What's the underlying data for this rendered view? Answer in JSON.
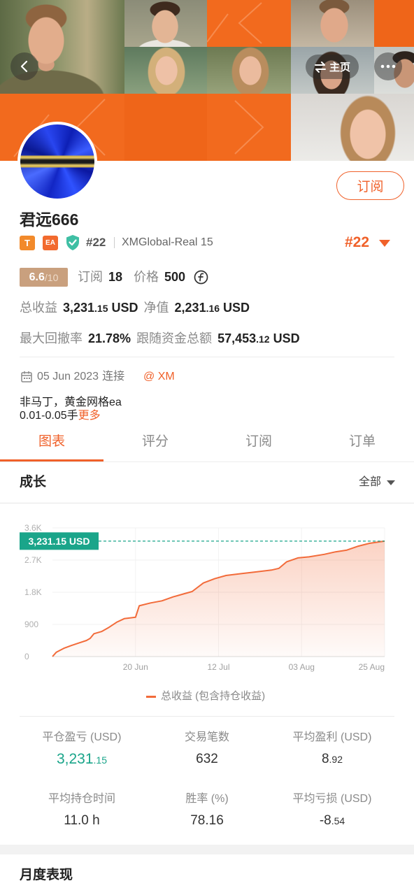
{
  "colors": {
    "accent": "#F0612A",
    "banner_orange": "#F26A1E",
    "teal": "#1AA58A",
    "rating_bg": "#C9A07E"
  },
  "header": {
    "back_icon": "chevron-left-icon",
    "home_icon": "swap-icon",
    "home_label": "主页",
    "more_icon": "more-dots-icon"
  },
  "profile": {
    "avatar": "avatar-image",
    "subscribe_label": "订阅",
    "name": "君远666",
    "badge_t": "T",
    "badge_ea": "EA",
    "verified_icon": "shield-check-icon",
    "rank": "#22",
    "account": "XMGlobal-Real 15",
    "rank_highlight": "#22",
    "rating": "6.6",
    "rating_max": "/10",
    "subscribers_label": "订阅",
    "subscribers": "18",
    "price_label": "价格",
    "price": "500",
    "price_icon": "coin-icon",
    "total_return_label": "总收益",
    "total_return_int": "3,231",
    "total_return_dec": ".15",
    "total_return_unit": "USD",
    "equity_label": "净值",
    "equity_int": "2,231",
    "equity_dec": ".16",
    "equity_unit": "USD",
    "max_drawdown_label": "最大回撤率",
    "max_drawdown": "21.78%",
    "follow_funds_label": "跟随资金总额",
    "follow_funds_int": "57,453",
    "follow_funds_dec": ".12",
    "follow_funds_unit": "USD",
    "calendar_icon": "calendar-icon",
    "connected_date": "05 Jun 2023",
    "connected_label": "连接",
    "broker": "@ XM",
    "description_line1": "非马丁，黄金网格ea",
    "description_line2": "0.01-0.05手",
    "more_label": "更多"
  },
  "tabs": [
    {
      "label": "图表",
      "active": true
    },
    {
      "label": "评分",
      "active": false
    },
    {
      "label": "订阅",
      "active": false
    },
    {
      "label": "订单",
      "active": false
    }
  ],
  "growth": {
    "title": "成长",
    "filter_label": "全部",
    "filter_icon": "caret-down-icon"
  },
  "chart_data": {
    "type": "area",
    "colors": {
      "line": "#F26B3A",
      "label": "#1AA58A"
    },
    "series": [
      {
        "name": "总收益 (包含持仓收益)",
        "x": [
          "2023-05-29",
          "2023-05-30",
          "2023-06-01",
          "2023-06-03",
          "2023-06-05",
          "2023-06-07",
          "2023-06-08",
          "2023-06-09",
          "2023-06-11",
          "2023-06-13",
          "2023-06-15",
          "2023-06-17",
          "2023-06-20",
          "2023-06-21",
          "2023-06-24",
          "2023-06-27",
          "2023-06-30",
          "2023-07-03",
          "2023-07-05",
          "2023-07-08",
          "2023-07-11",
          "2023-07-14",
          "2023-07-18",
          "2023-07-22",
          "2023-07-26",
          "2023-07-28",
          "2023-07-30",
          "2023-08-02",
          "2023-08-05",
          "2023-08-09",
          "2023-08-12",
          "2023-08-15",
          "2023-08-18",
          "2023-08-21",
          "2023-08-25"
        ],
        "y": [
          0,
          120,
          230,
          310,
          380,
          450,
          510,
          640,
          700,
          820,
          960,
          1060,
          1100,
          1420,
          1500,
          1560,
          1670,
          1760,
          1820,
          2060,
          2180,
          2270,
          2320,
          2370,
          2420,
          2470,
          2650,
          2760,
          2790,
          2860,
          2930,
          2980,
          3090,
          3170,
          3231.15
        ]
      }
    ],
    "xlim": [
      "2023-05-29",
      "2023-08-25"
    ],
    "ylim": [
      0,
      3600
    ],
    "x_ticks": [
      {
        "date": "2023-06-20",
        "label": "20 Jun"
      },
      {
        "date": "2023-07-12",
        "label": "12 Jul"
      },
      {
        "date": "2023-08-03",
        "label": "03 Aug"
      },
      {
        "date": "2023-08-25",
        "label": "25 Aug"
      }
    ],
    "y_ticks": [
      {
        "value": 0,
        "label": "0"
      },
      {
        "value": 900,
        "label": "900"
      },
      {
        "value": 1800,
        "label": "1.8K"
      },
      {
        "value": 2700,
        "label": "2.7K"
      },
      {
        "value": 3600,
        "label": "3.6K"
      }
    ],
    "last_value_label": "3,231.15 USD",
    "grid": true,
    "legend": "bottom-center"
  },
  "stats": [
    {
      "label": "平仓盈亏 (USD)",
      "int": "3,231",
      "dec": ".15"
    },
    {
      "label": "交易笔数",
      "int": "632",
      "dec": ""
    },
    {
      "label": "平均盈利 (USD)",
      "int": "8",
      "dec": ".92"
    },
    {
      "label": "平均持仓时间",
      "int": "11.0 h",
      "dec": ""
    },
    {
      "label": "胜率 (%)",
      "int": "78.16",
      "dec": ""
    },
    {
      "label": "平均亏损 (USD)",
      "int": "-8",
      "dec": ".54"
    }
  ],
  "monthly": {
    "title": "月度表现"
  }
}
